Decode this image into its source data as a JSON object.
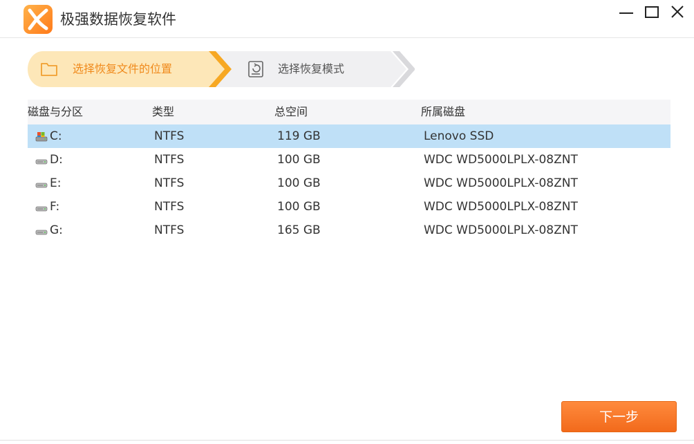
{
  "app": {
    "title": "极强数据恢复软件"
  },
  "window_controls": {
    "minimize": "minimize-icon",
    "maximize": "maximize-icon",
    "close": "close-icon"
  },
  "steps": [
    {
      "label": "选择恢复文件的位置",
      "icon": "folder-icon",
      "active": true
    },
    {
      "label": "选择恢复模式",
      "icon": "recovery-mode-icon",
      "active": false
    }
  ],
  "table": {
    "headers": [
      "磁盘与分区",
      "类型",
      "总空间",
      "所属磁盘"
    ],
    "rows": [
      {
        "drive": "C:",
        "type": "NTFS",
        "size": "119 GB",
        "disk": "Lenovo SSD",
        "icon": "system-drive-icon",
        "selected": true
      },
      {
        "drive": "D:",
        "type": "NTFS",
        "size": "100 GB",
        "disk": "WDC WD5000LPLX-08ZNT",
        "icon": "drive-icon",
        "selected": false
      },
      {
        "drive": "E:",
        "type": "NTFS",
        "size": "100 GB",
        "disk": "WDC WD5000LPLX-08ZNT",
        "icon": "drive-icon",
        "selected": false
      },
      {
        "drive": "F:",
        "type": "NTFS",
        "size": "100 GB",
        "disk": "WDC WD5000LPLX-08ZNT",
        "icon": "drive-icon",
        "selected": false
      },
      {
        "drive": "G:",
        "type": "NTFS",
        "size": "165 GB",
        "disk": "WDC WD5000LPLX-08ZNT",
        "icon": "drive-icon",
        "selected": false
      }
    ]
  },
  "footer": {
    "next_label": "下一步"
  },
  "colors": {
    "accent": "#f08a1c",
    "selected_row": "#bfe0f7",
    "header_bg": "#f5f5f7",
    "button": "#f26a1b"
  }
}
